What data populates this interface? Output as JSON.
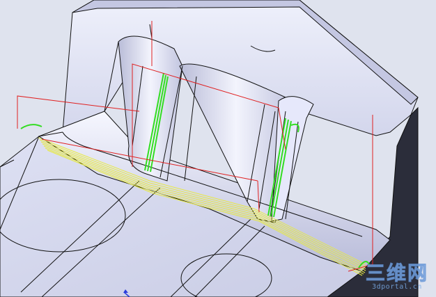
{
  "viewport": {
    "title": "",
    "background": "#dfe3ee",
    "model_color": "#d8dbf0",
    "edge_color": "#111111",
    "toolpath_red": "#e02020",
    "toolpath_green": "#33dd22",
    "toolpath_yellow": "#e8ea40",
    "dark_side_color": "#2b2d3a"
  },
  "watermark": {
    "brand": "三维网",
    "site": "3dportal.cn"
  },
  "icons": {
    "triad": "axis-triad-icon"
  }
}
